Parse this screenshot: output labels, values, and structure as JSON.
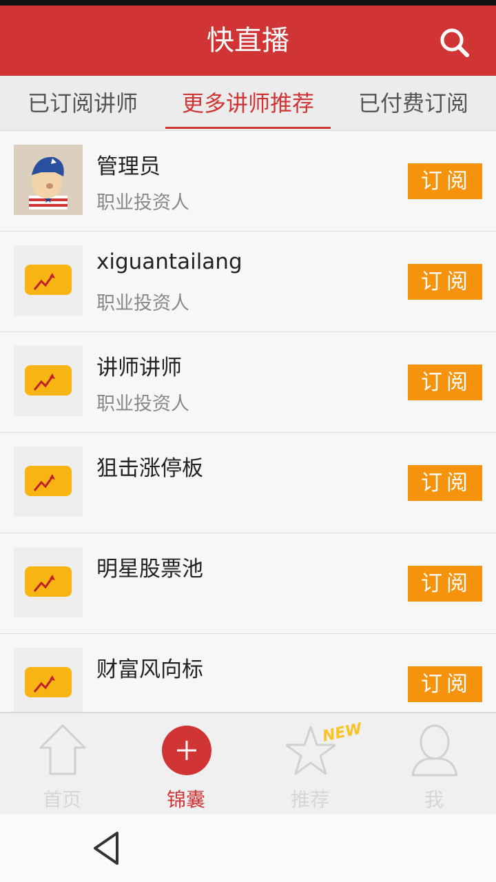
{
  "header": {
    "title": "快直播",
    "search_icon": "search-icon"
  },
  "tabs": [
    {
      "label": "已订阅讲师",
      "active": false
    },
    {
      "label": "更多讲师推荐",
      "active": true
    },
    {
      "label": "已付费订阅",
      "active": false
    }
  ],
  "lecturers": [
    {
      "name": "管理员",
      "subtitle": "职业投资人",
      "avatar": "captain-avatar",
      "button": "订阅"
    },
    {
      "name": "xiguantailang",
      "subtitle": "职业投资人",
      "avatar": "chart-logo-avatar",
      "button": "订阅"
    },
    {
      "name": "讲师讲师",
      "subtitle": "职业投资人",
      "avatar": "chart-logo-avatar",
      "button": "订阅"
    },
    {
      "name": "狙击涨停板",
      "subtitle": "",
      "avatar": "chart-logo-avatar",
      "button": "订阅"
    },
    {
      "name": "明星股票池",
      "subtitle": "",
      "avatar": "chart-logo-avatar",
      "button": "订阅"
    },
    {
      "name": "财富风向标",
      "subtitle": "",
      "avatar": "chart-logo-avatar",
      "button": "订阅"
    }
  ],
  "bottom_nav": [
    {
      "label": "首页",
      "icon": "home-icon",
      "active": false
    },
    {
      "label": "锦囊",
      "icon": "plus-icon",
      "active": true
    },
    {
      "label": "推荐",
      "icon": "star-icon",
      "active": false,
      "badge": "NEW"
    },
    {
      "label": "我",
      "icon": "user-icon",
      "active": false
    }
  ],
  "colors": {
    "brand": "#d13434",
    "subscribe": "#f5940c"
  }
}
